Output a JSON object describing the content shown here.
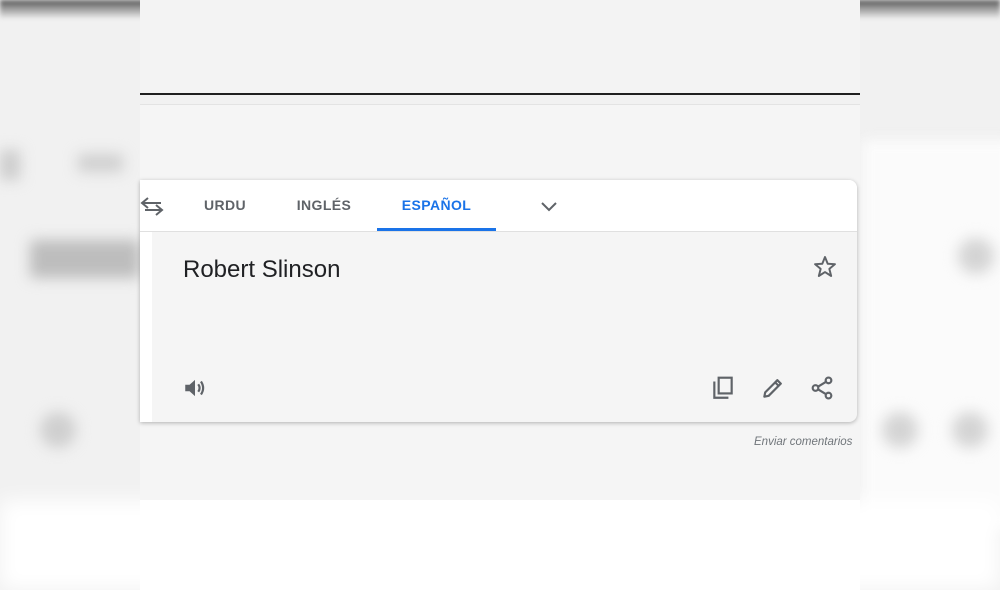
{
  "tabs": [
    {
      "label": "URDU",
      "active": false
    },
    {
      "label": "INGLÉS",
      "active": false
    },
    {
      "label": "ESPAÑOL",
      "active": true
    }
  ],
  "translation": {
    "text": "Robert Slinson"
  },
  "feedback_link": "Enviar comentarios",
  "icons": [
    "swap-languages-icon",
    "chevron-down-icon",
    "star-icon",
    "speaker-icon",
    "copy-icon",
    "pencil-icon",
    "share-icon"
  ],
  "colors": {
    "accent": "#1a73e8",
    "text": "#202124",
    "muted": "#5f6368"
  }
}
